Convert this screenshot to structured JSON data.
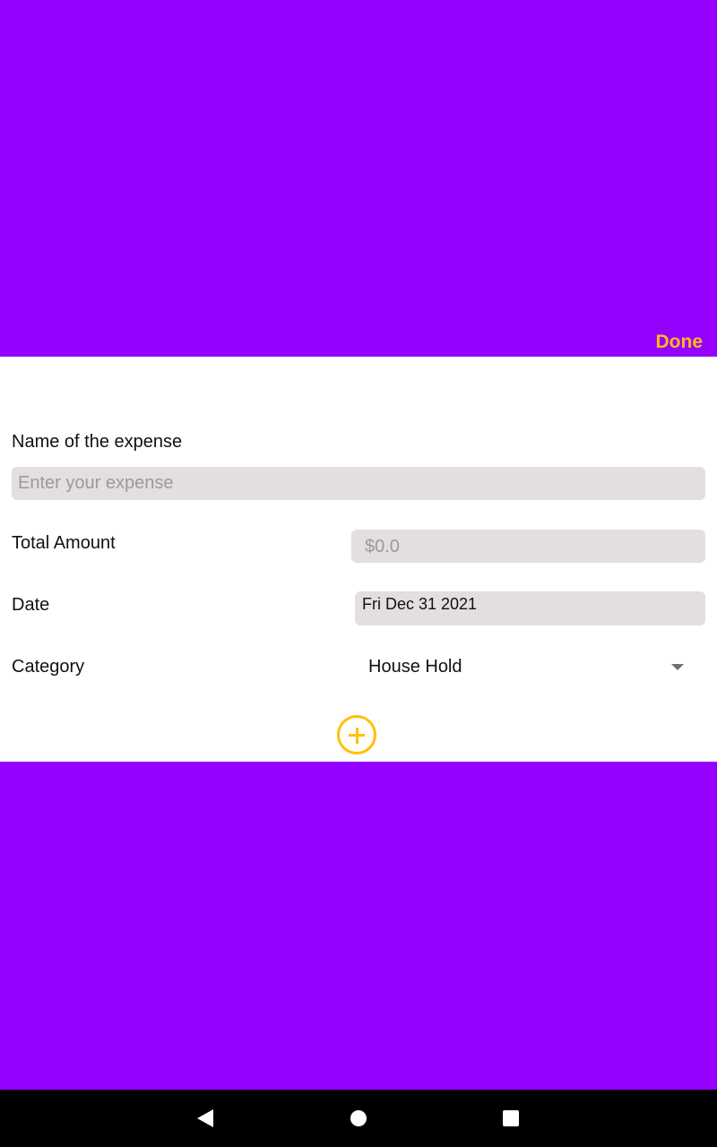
{
  "header": {
    "done_label": "Done"
  },
  "form": {
    "name_label": "Name of the expense",
    "name_placeholder": "Enter your expense",
    "amount_label": "Total Amount",
    "amount_placeholder": "$0.0",
    "date_label": "Date",
    "date_value": "Fri Dec 31 2021",
    "category_label": "Category",
    "category_value": "House Hold"
  },
  "icons": {
    "add": "plus-circle-icon",
    "dropdown": "caret-down-icon",
    "nav_back": "triangle-back-icon",
    "nav_home": "circle-home-icon",
    "nav_recents": "square-recents-icon"
  },
  "colors": {
    "background": "#9500ff",
    "accent": "#ffb81c",
    "field_bg": "#e2dfde",
    "nav_bar": "#000000"
  }
}
